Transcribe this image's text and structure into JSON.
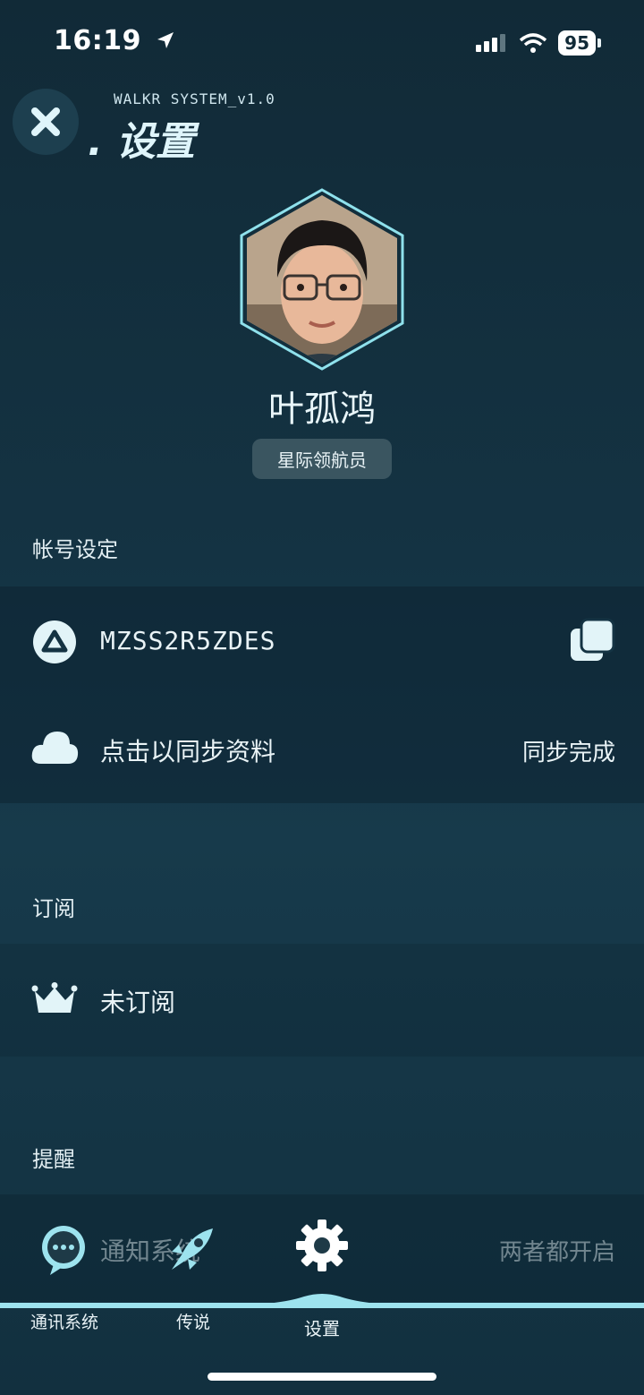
{
  "status_bar": {
    "time": "16:19",
    "battery": "95"
  },
  "header": {
    "system_label": "WALKR SYSTEM_v1.0",
    "title": ". 设置"
  },
  "profile": {
    "name": "叶孤鸿",
    "rank": "星际领航员"
  },
  "account": {
    "section_title": "帐号设定",
    "id": "MZSS2R5ZDES",
    "sync_label": "点击以同步资料",
    "sync_status": "同步完成"
  },
  "subscription": {
    "section_title": "订阅",
    "status": "未订阅"
  },
  "reminder": {
    "section_title": "提醒",
    "item_label": "通知系统",
    "item_value": "两者都开启"
  },
  "bottom_nav": {
    "items": [
      {
        "label": "通讯系统"
      },
      {
        "label": "传说"
      },
      {
        "label": "设置"
      }
    ]
  },
  "colors": {
    "background": "#143343",
    "accent": "#9de3ee",
    "badge": "#3a5560"
  }
}
